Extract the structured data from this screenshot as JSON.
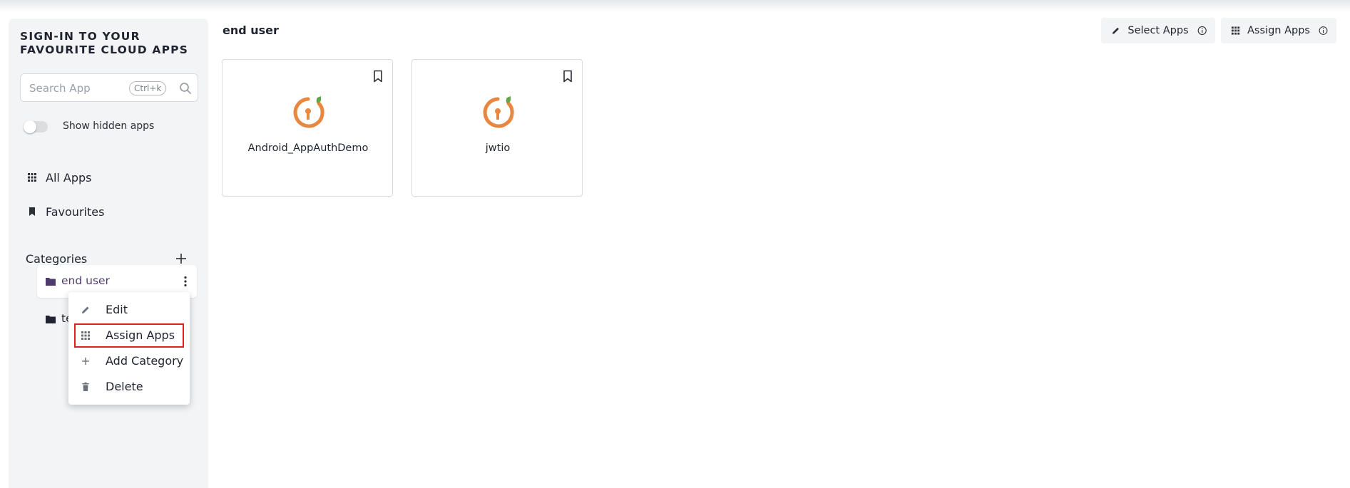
{
  "sidebar": {
    "brand_line1": "SIGN-IN TO YOUR",
    "brand_line2": "FAVOURITE CLOUD APPS",
    "search": {
      "placeholder": "Search App",
      "shortcut": "Ctrl+k"
    },
    "toggle": {
      "label": "Show hidden apps",
      "on": false
    },
    "nav": [
      {
        "label": "All Apps",
        "icon": "grid-icon"
      },
      {
        "label": "Favourites",
        "icon": "bookmark-icon"
      }
    ],
    "categories_label": "Categories",
    "categories": [
      {
        "label": "end user",
        "icon": "folder-icon",
        "selected": true
      },
      {
        "label": "te",
        "icon": "folder-icon",
        "selected": false
      }
    ]
  },
  "context_menu": {
    "items": [
      {
        "label": "Edit",
        "icon": "pencil-icon"
      },
      {
        "label": "Assign Apps",
        "icon": "grid-icon",
        "highlighted": true
      },
      {
        "label": "Add Category",
        "icon": "plus-icon"
      },
      {
        "label": "Delete",
        "icon": "trash-icon"
      }
    ]
  },
  "main": {
    "title": "end user",
    "buttons": [
      {
        "label": "Select Apps",
        "icon": "pencil-icon"
      },
      {
        "label": "Assign Apps",
        "icon": "grid-icon"
      }
    ],
    "apps": [
      {
        "name": "Android_AppAuthDemo"
      },
      {
        "name": "jwtio"
      }
    ]
  },
  "colors": {
    "accent_purple": "#4e3a6e",
    "logo_orange": "#e8873f",
    "logo_green": "#5fa745",
    "highlight_red": "#e0201c"
  }
}
